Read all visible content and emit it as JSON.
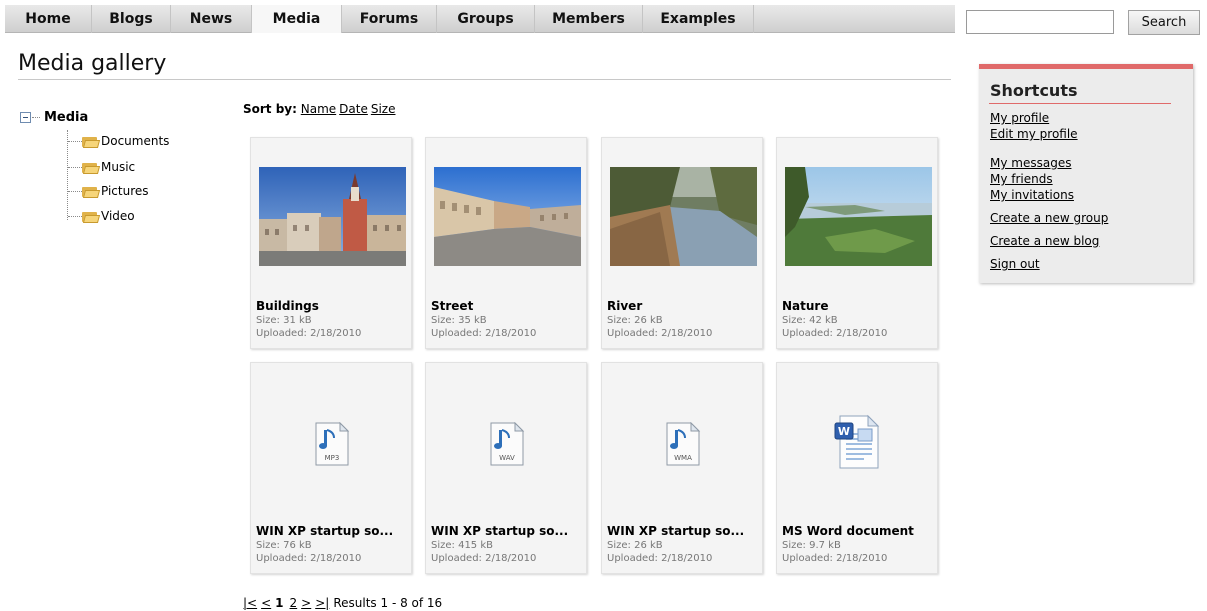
{
  "nav": {
    "items": [
      "Home",
      "Blogs",
      "News",
      "Media",
      "Forums",
      "Groups",
      "Members",
      "Examples"
    ],
    "active": "Media"
  },
  "search": {
    "value": "",
    "button_label": "Search"
  },
  "page": {
    "title": "Media gallery"
  },
  "tree": {
    "root": "Media",
    "children": [
      "Documents",
      "Music",
      "Pictures",
      "Video"
    ]
  },
  "sort": {
    "label": "Sort by:",
    "options": [
      "Name",
      "Date",
      "Size"
    ]
  },
  "gallery": {
    "items": [
      {
        "name": "Buildings",
        "size": "Size: 31 kB",
        "uploaded": "Uploaded: 2/18/2010",
        "kind": "photo-buildings"
      },
      {
        "name": "Street",
        "size": "Size: 35 kB",
        "uploaded": "Uploaded: 2/18/2010",
        "kind": "photo-street"
      },
      {
        "name": "River",
        "size": "Size: 26 kB",
        "uploaded": "Uploaded: 2/18/2010",
        "kind": "photo-river"
      },
      {
        "name": "Nature",
        "size": "Size: 42 kB",
        "uploaded": "Uploaded: 2/18/2010",
        "kind": "photo-nature"
      },
      {
        "name": "WIN XP startup so...",
        "size": "Size: 76 kB",
        "uploaded": "Uploaded: 2/18/2010",
        "kind": "audio-file-icon",
        "ext": "MP3"
      },
      {
        "name": "WIN XP startup so...",
        "size": "Size: 415 kB",
        "uploaded": "Uploaded: 2/18/2010",
        "kind": "audio-file-icon",
        "ext": "WAV"
      },
      {
        "name": "WIN XP startup so...",
        "size": "Size: 26 kB",
        "uploaded": "Uploaded: 2/18/2010",
        "kind": "audio-file-icon",
        "ext": "WMA"
      },
      {
        "name": "MS Word document",
        "size": "Size: 9.7 kB",
        "uploaded": "Uploaded: 2/18/2010",
        "kind": "word-document-icon"
      }
    ]
  },
  "pager": {
    "first": "|<",
    "prev": "<",
    "current": "1",
    "page2": "2",
    "next": ">",
    "last": ">|",
    "results": "Results 1 - 8 of 16"
  },
  "shortcuts": {
    "title": "Shortcuts",
    "links": [
      "My profile",
      "Edit my profile",
      "My messages",
      "My friends",
      "My invitations",
      "Create a new group",
      "Create a new blog",
      "Sign out"
    ]
  },
  "colors": {
    "accent": "#e06a6a",
    "nav_bg": "#d9d9d9",
    "card_bg": "#f4f4f4",
    "panel_bg": "#ececec"
  }
}
